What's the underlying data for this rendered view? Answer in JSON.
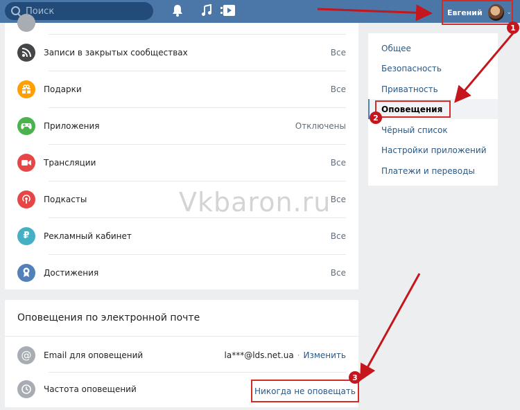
{
  "header": {
    "search_placeholder": "Поиск",
    "user_name": "Евгений"
  },
  "notifications": {
    "rows": [
      {
        "label": "Записи в закрытых сообществах",
        "value": "Все",
        "icon": "rss-icon",
        "color": "#454647"
      },
      {
        "label": "Подарки",
        "value": "Все",
        "icon": "gift-icon",
        "color": "#ffa000"
      },
      {
        "label": "Приложения",
        "value": "Отключены",
        "icon": "gamepad-icon",
        "color": "#4bb34b"
      },
      {
        "label": "Трансляции",
        "value": "Все",
        "icon": "video-camera-icon",
        "color": "#e64646"
      },
      {
        "label": "Подкасты",
        "value": "Все",
        "icon": "podcast-icon",
        "color": "#e64646"
      },
      {
        "label": "Рекламный кабинет",
        "value": "Все",
        "icon": "ruble-icon",
        "color": "#45b0c5"
      },
      {
        "label": "Достижения",
        "value": "Все",
        "icon": "medal-icon",
        "color": "#5181b8"
      }
    ]
  },
  "email": {
    "title": "Оповещения по электронной почте",
    "email_label": "Email для оповещений",
    "email_value": "la***@lds.net.ua",
    "change_link": "Изменить",
    "frequency_label": "Частота оповещений",
    "frequency_value": "Никогда не оповещать"
  },
  "menu": {
    "items": [
      {
        "label": "Общее"
      },
      {
        "label": "Безопасность"
      },
      {
        "label": "Приватность"
      },
      {
        "label": "Оповещения"
      },
      {
        "label": "Чёрный список"
      },
      {
        "label": "Настройки приложений"
      },
      {
        "label": "Платежи и переводы"
      }
    ],
    "active_index": 3
  },
  "annotations": {
    "badges": [
      "1",
      "2",
      "3"
    ],
    "watermark": "Vkbaron.ru",
    "accent_color": "#d42c25"
  }
}
